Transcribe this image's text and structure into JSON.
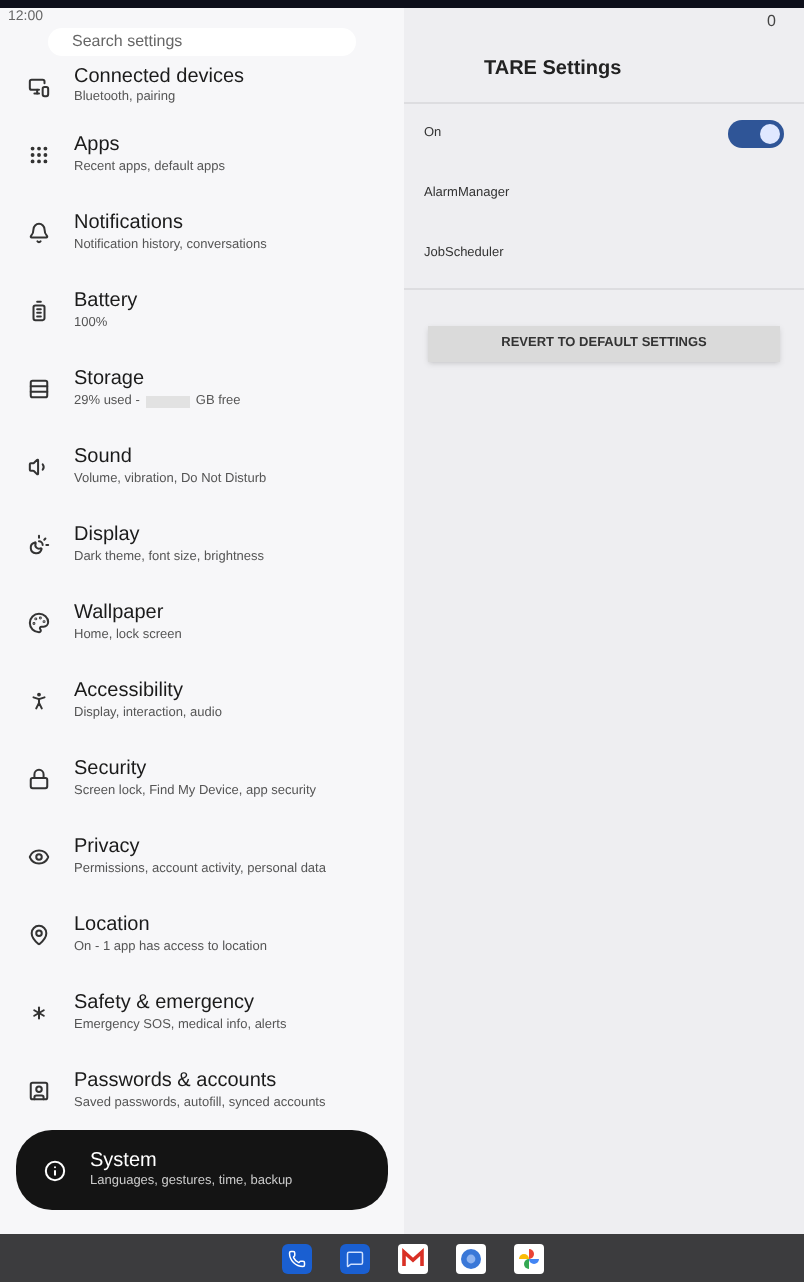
{
  "status_bar": {
    "time": "12:00",
    "indicator": "0"
  },
  "search": {
    "placeholder": "Search settings"
  },
  "settings_list": [
    {
      "title": "Connected devices",
      "subtitle": "Bluetooth, pairing",
      "selected": false
    },
    {
      "title": "Apps",
      "subtitle": "Recent apps, default apps",
      "selected": false
    },
    {
      "title": "Notifications",
      "subtitle": "Notification history, conversations",
      "selected": false
    },
    {
      "title": "Battery",
      "subtitle": "100%",
      "selected": false
    },
    {
      "title": "Storage",
      "subtitle": "29% used -",
      "redacted": true,
      "subtitle_after": "GB free",
      "selected": false
    },
    {
      "title": "Sound",
      "subtitle": "Volume, vibration, Do Not Disturb",
      "selected": false
    },
    {
      "title": "Display",
      "subtitle": "Dark theme, font size, brightness",
      "selected": false
    },
    {
      "title": "Wallpaper",
      "subtitle": "Home, lock screen",
      "selected": false
    },
    {
      "title": "Accessibility",
      "subtitle": "Display, interaction, audio",
      "selected": false
    },
    {
      "title": "Security",
      "subtitle": "Screen lock, Find My Device, app security",
      "selected": false
    },
    {
      "title": "Privacy",
      "subtitle": "Permissions, account activity, personal data",
      "selected": false
    },
    {
      "title": "Location",
      "subtitle": "On - 1 app has access to location",
      "selected": false
    },
    {
      "title": "Safety & emergency",
      "subtitle": "Emergency SOS, medical info, alerts",
      "selected": false
    },
    {
      "title": "Passwords & accounts",
      "subtitle": "Saved passwords, autofill, synced accounts",
      "selected": false
    },
    {
      "title": "System",
      "subtitle": "Languages, gestures, time, backup",
      "selected": true
    }
  ],
  "detail": {
    "title": "TARE Settings",
    "rows": [
      {
        "kind": "toggle",
        "label": "On",
        "on": true
      },
      {
        "kind": "text",
        "label": "AlarmManager"
      },
      {
        "kind": "text",
        "label": "JobScheduler"
      }
    ],
    "button": "REVERT TO DEFAULT SETTINGS"
  }
}
